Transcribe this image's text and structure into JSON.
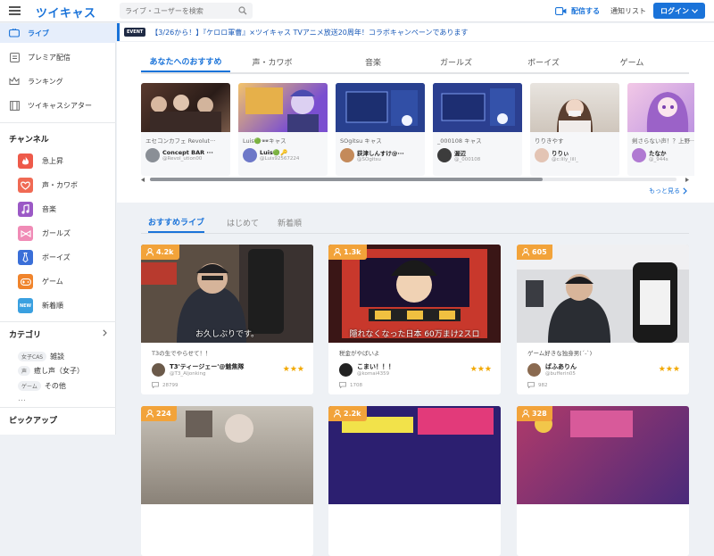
{
  "header": {
    "logo": "ツイキャス",
    "search_placeholder": "ライブ・ユーザーを検索",
    "broadcast_label": "配信する",
    "notifications_label": "通知リスト",
    "login_label": "ログイン"
  },
  "sidebar": {
    "nav": [
      {
        "label": "ライブ",
        "icon": "live-icon"
      },
      {
        "label": "プレミア配信",
        "icon": "premier-icon"
      },
      {
        "label": "ランキング",
        "icon": "crown-icon"
      },
      {
        "label": "ツイキャスシアター",
        "icon": "theater-icon"
      }
    ],
    "channels_title": "チャンネル",
    "channels": [
      {
        "label": "急上昇",
        "icon": "flame-icon",
        "color": "#ee5a4a"
      },
      {
        "label": "声・カワボ",
        "icon": "heart-icon",
        "color": "#f06a54"
      },
      {
        "label": "音楽",
        "icon": "music-icon",
        "color": "#9b59c6"
      },
      {
        "label": "ガールズ",
        "icon": "bow-icon",
        "color": "#f08bb6"
      },
      {
        "label": "ボーイズ",
        "icon": "necktie-icon",
        "color": "#3a6fd8"
      },
      {
        "label": "ゲーム",
        "icon": "gamepad-icon",
        "color": "#f0842c"
      },
      {
        "label": "新着順",
        "icon": "new-icon",
        "color": "#3aa0e0"
      }
    ],
    "categories_title": "カテゴリ",
    "categories": [
      {
        "tag": "女子CAS",
        "label": "雑談"
      },
      {
        "tag": "声",
        "label": "癒し声（女子）"
      },
      {
        "tag": "ゲーム",
        "label": "その他"
      }
    ],
    "ellipsis": "…",
    "pickup_title": "ピックアップ"
  },
  "event": {
    "badge": "EVENT",
    "text": "【3/26から！】『ケロロ軍曹』×ツイキャス TVアニメ放送20周年！コラボキャンペーンであります"
  },
  "recommend": {
    "tabs": [
      "あなたへのおすすめ",
      "声・カワボ",
      "音楽",
      "ガールズ",
      "ボーイズ",
      "ゲーム"
    ],
    "cards": [
      {
        "caption": "エセコンカフェ Revolut···",
        "name": "Concept BAR ···",
        "id": "@Revol_ution00"
      },
      {
        "caption": "Luis🟢🕶キャス",
        "name": "Luis🟢🔑",
        "id": "@Luis92567224"
      },
      {
        "caption": "SOgitsu キャス",
        "name": "荻津しんすけ@···",
        "id": "@SOgitsu"
      },
      {
        "caption": "_000108 キャス",
        "name": "渥辺",
        "id": "@_000108"
      },
      {
        "caption": "りりきやす",
        "name": "りりぃ",
        "id": "@c:lily_lill_"
      },
      {
        "caption": "剣さらない声！？上野···",
        "name": "たなか",
        "id": "@_944s"
      }
    ],
    "more_label": "もっと見る"
  },
  "live": {
    "tabs": [
      "おすすめライブ",
      "はじめて",
      "新着順"
    ],
    "cards": [
      {
        "viewers": "4.2k",
        "subtitle": "お久しぶりです。",
        "title": "T3の生でやらせて！！",
        "name": "T3'ティージェー'@魅焦隊",
        "id": "@T3_Aljonking",
        "comments": "28799",
        "stars": "★★★"
      },
      {
        "viewers": "1.3k",
        "subtitle": "隠れなくなった日本 60万まけ2スロ",
        "title": "税金がやばいよ",
        "name": "こまい！！！",
        "id": "@komai4359",
        "comments": "1708",
        "stars": "★★★"
      },
      {
        "viewers": "605",
        "subtitle": "",
        "title": "ゲーム好きな独身男(´-`)",
        "name": "ばふありん",
        "id": "@bufferin05",
        "comments": "982",
        "stars": "★★★"
      },
      {
        "viewers": "224"
      },
      {
        "viewers": "2.2k"
      },
      {
        "viewers": "328"
      }
    ]
  }
}
